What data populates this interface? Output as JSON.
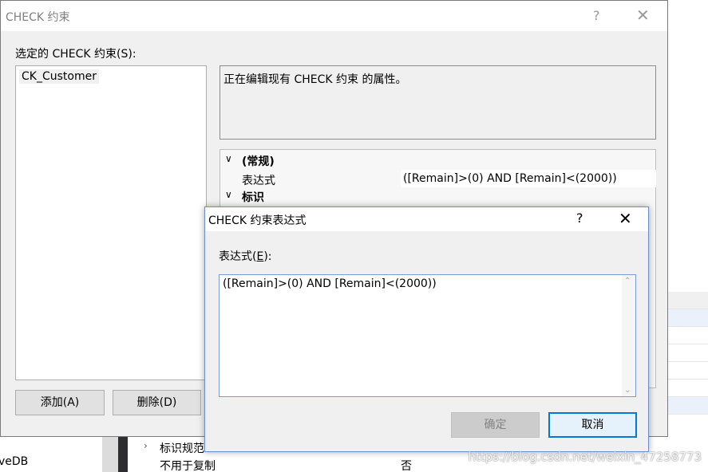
{
  "background": {
    "bottom_left_text": "veDB",
    "props": [
      {
        "key": "标识规范",
        "value": ""
      },
      {
        "key": "不用于复制",
        "value": "否"
      }
    ],
    "watermark": "https://blog.csdn.net/weixin_47258773"
  },
  "check_dialog": {
    "title": "CHECK 约束",
    "help_glyph": "?",
    "close_glyph": "✕",
    "selected_label": "选定的 CHECK 约束(S):",
    "constraints": [
      "CK_Customer"
    ],
    "description": "正在编辑现有 CHECK 约束 的属性。",
    "grid": {
      "categories": [
        {
          "label": "(常规)",
          "expanded": true,
          "props": [
            {
              "key": "表达式",
              "value": "([Remain]>(0) AND [Remain]<(2000))"
            }
          ]
        },
        {
          "label": "标识",
          "expanded": true,
          "props": []
        }
      ]
    },
    "buttons": {
      "add": "添加(A)",
      "delete": "删除(D)"
    }
  },
  "expression_dialog": {
    "title": "CHECK 约束表达式",
    "help_glyph": "?",
    "close_glyph": "✕",
    "label_prefix": "表达式(",
    "label_key": "E",
    "label_suffix": "):",
    "expression": "([Remain]>(0) AND [Remain]<(2000))",
    "buttons": {
      "ok": "确定",
      "cancel": "取消"
    },
    "ok_enabled": false
  },
  "colors": {
    "focus_border": "#0078d7",
    "dialog_bg": "#f0f0f0"
  }
}
